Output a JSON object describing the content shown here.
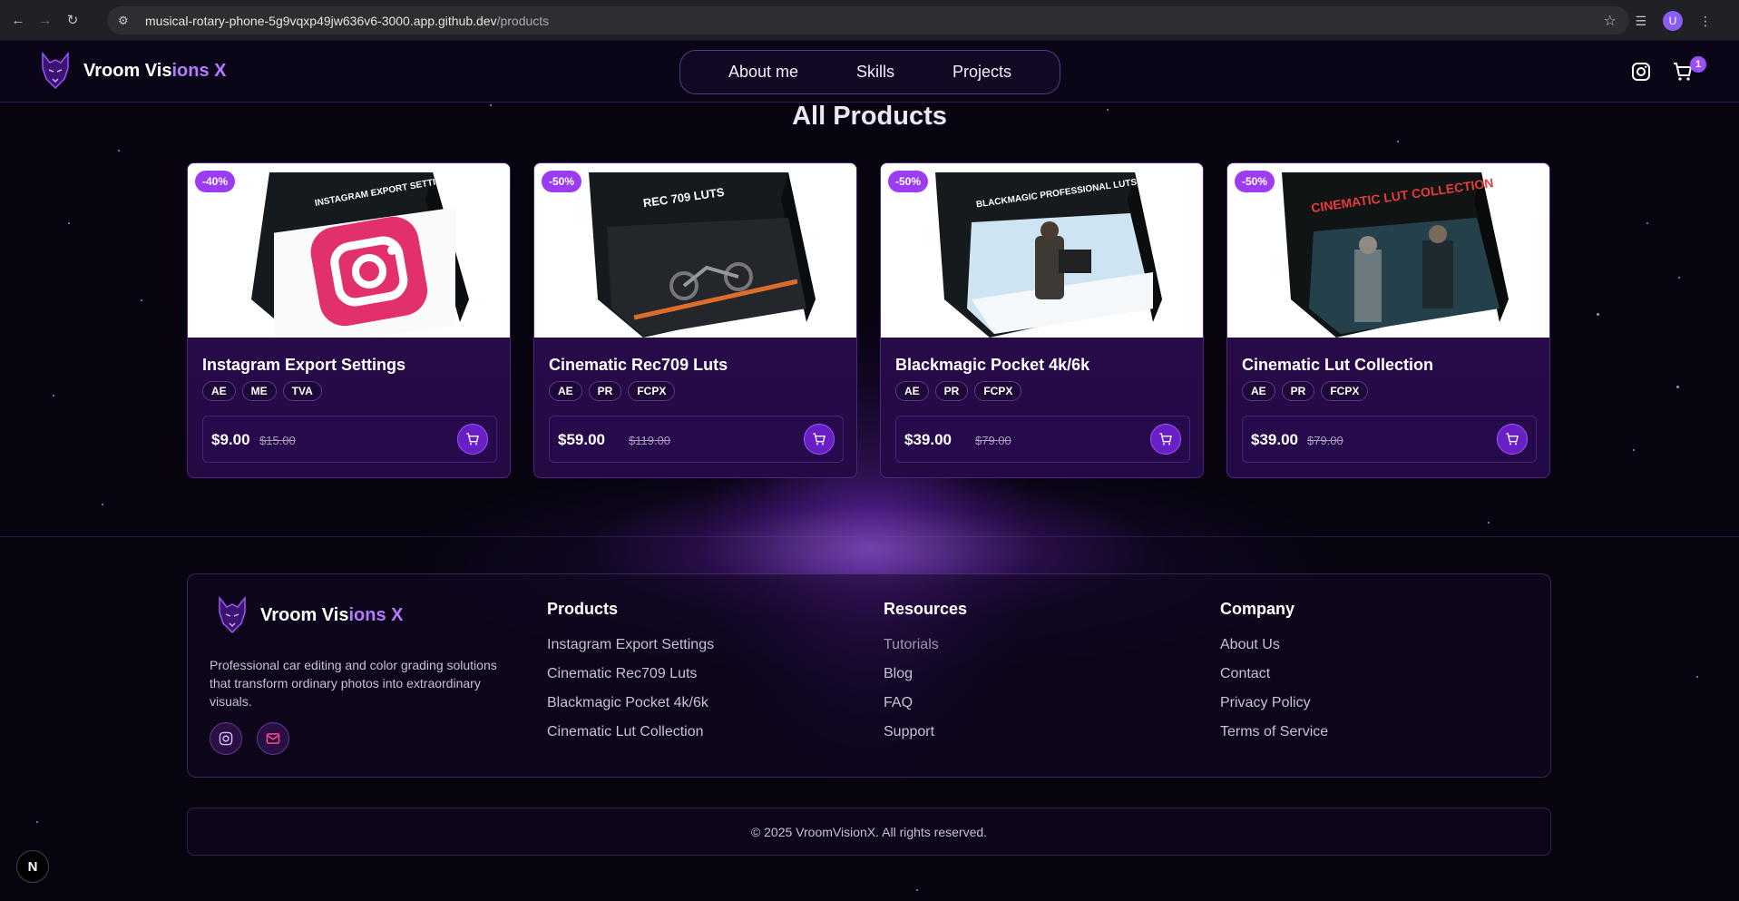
{
  "browser": {
    "url_host": "musical-rotary-phone-5g9vqxp49jw636v6-3000.app.github.dev",
    "url_path": "/products",
    "profile_initial": "U"
  },
  "header": {
    "brand_main": "Vroom Vis",
    "brand_accent": "ions X",
    "nav": [
      "About me",
      "Skills",
      "Projects"
    ],
    "cart_count": "1"
  },
  "page_title": "All Products",
  "products": [
    {
      "name": "Instagram Export Settings",
      "discount": "-40%",
      "tags": [
        "AE",
        "ME",
        "TVA"
      ],
      "price": "$9.00",
      "old_price": "$15.00",
      "box_title": "INSTAGRAM EXPORT SETTINGS"
    },
    {
      "name": "Cinematic Rec709 Luts",
      "discount": "-50%",
      "tags": [
        "AE",
        "PR",
        "FCPX"
      ],
      "price": "$59.00",
      "old_price": "$119.00",
      "box_title": "REC 709 LUTS"
    },
    {
      "name": "Blackmagic Pocket 4k/6k",
      "discount": "-50%",
      "tags": [
        "AE",
        "PR",
        "FCPX"
      ],
      "price": "$39.00",
      "old_price": "$79.00",
      "box_title": "BLACKMAGIC PROFESSIONAL LUTS"
    },
    {
      "name": "Cinematic Lut Collection",
      "discount": "-50%",
      "tags": [
        "AE",
        "PR",
        "FCPX"
      ],
      "price": "$39.00",
      "old_price": "$79.00",
      "box_title": "CINEMATIC LUT COLLECTION"
    }
  ],
  "footer": {
    "brand_main": "Vroom Vis",
    "brand_accent": "ions X",
    "description": "Professional car editing and color grading solutions that transform ordinary photos into extraordinary visuals.",
    "columns": [
      {
        "title": "Products",
        "links": [
          "Instagram Export Settings",
          "Cinematic Rec709 Luts",
          "Blackmagic Pocket 4k/6k",
          "Cinematic Lut Collection"
        ]
      },
      {
        "title": "Resources",
        "links": [
          "Tutorials",
          "Blog",
          "FAQ",
          "Support"
        ]
      },
      {
        "title": "Company",
        "links": [
          "About Us",
          "Contact",
          "Privacy Policy",
          "Terms of Service"
        ]
      }
    ],
    "copyright": "© 2025 VroomVisionX. All rights reserved."
  },
  "dev_badge": "N",
  "colors": {
    "accent": "#b47cff",
    "discount": "#9b3cf0",
    "card": "#2a0c4d"
  }
}
